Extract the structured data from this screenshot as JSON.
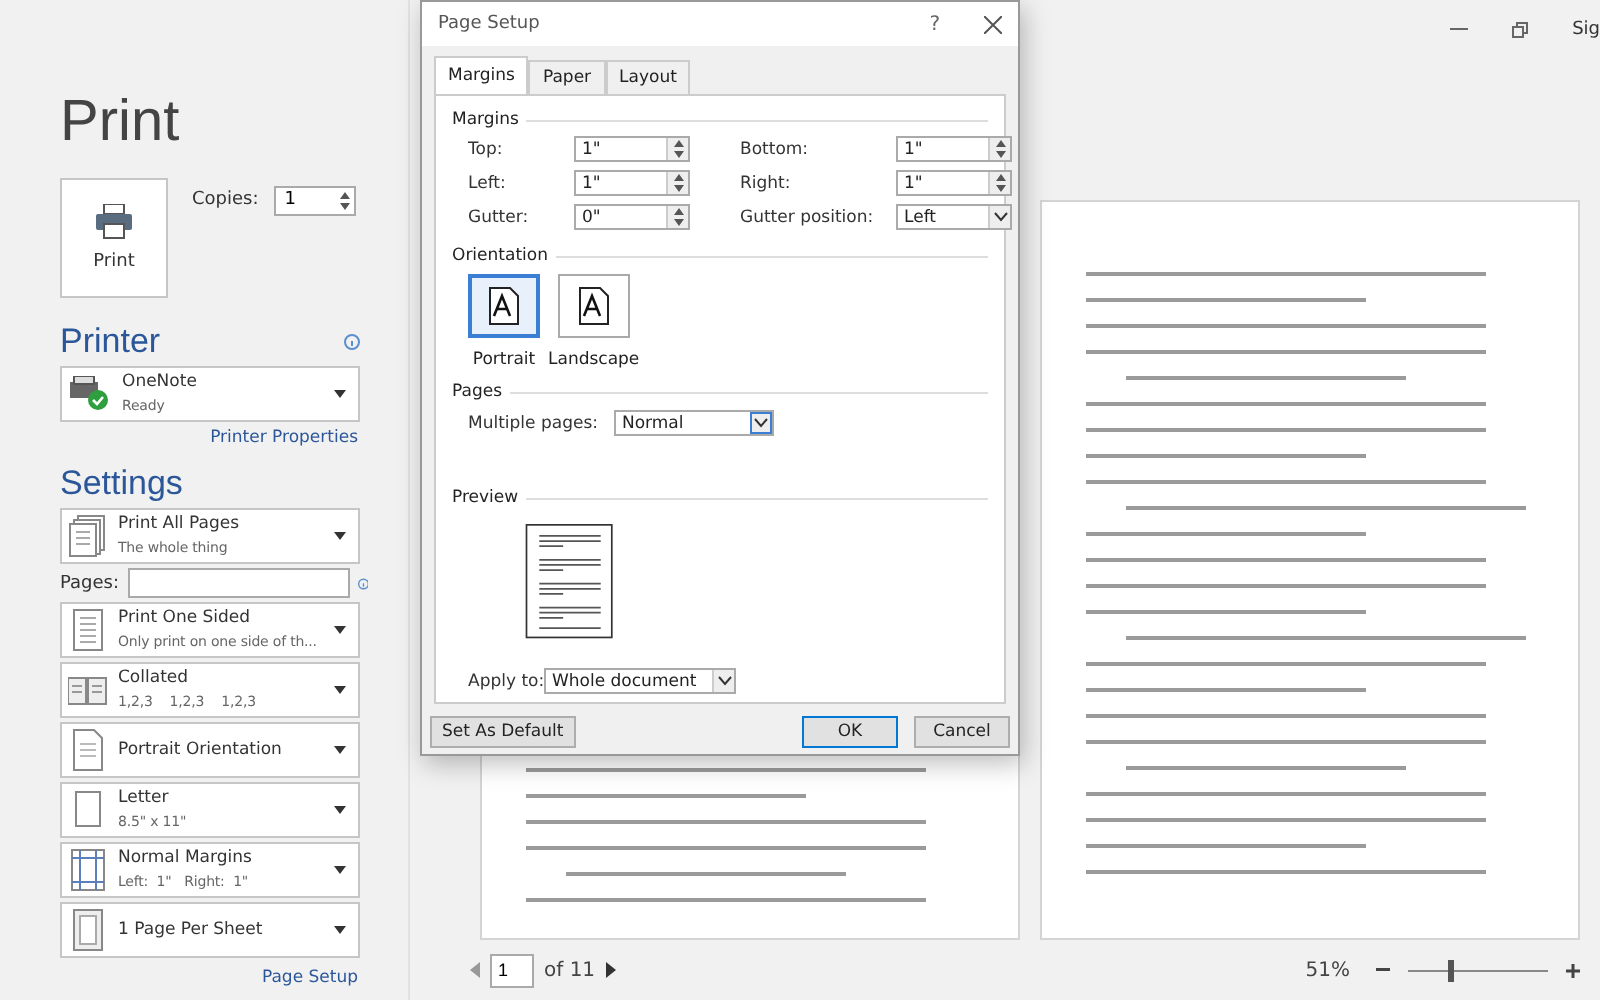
{
  "top_bar": {
    "account_label": "Sig"
  },
  "print": {
    "title": "Print",
    "print_button": "Print",
    "copies_label": "Copies:",
    "copies": "1"
  },
  "printer": {
    "heading": "Printer",
    "name": "OneNote",
    "status": "Ready",
    "properties_link": "Printer Properties"
  },
  "settings": {
    "heading": "Settings",
    "items": [
      {
        "kind": "dropdown",
        "title": "Print All Pages",
        "subtitle": "The whole thing"
      },
      {
        "kind": "pages_field",
        "label": "Pages:"
      },
      {
        "kind": "dropdown",
        "title": "Print One Sided",
        "subtitle": "Only print on one side of th..."
      },
      {
        "kind": "dropdown",
        "title": "Collated",
        "subtitle": "1,2,3    1,2,3    1,2,3"
      },
      {
        "kind": "dropdown",
        "title": "Portrait Orientation"
      },
      {
        "kind": "dropdown",
        "title": "Letter",
        "subtitle": "8.5\" x 11\""
      },
      {
        "kind": "dropdown",
        "title": "Normal Margins",
        "subtitle": "Left:  1\"   Right:  1\""
      },
      {
        "kind": "dropdown",
        "title": "1 Page Per Sheet"
      }
    ],
    "page_setup_link": "Page Setup"
  },
  "dialog": {
    "title": "Page Setup",
    "help": "?",
    "tabs": [
      {
        "label": "Margins",
        "selected": true
      },
      {
        "label": "Paper",
        "selected": false
      },
      {
        "label": "Layout",
        "selected": false
      }
    ],
    "margins_heading": "Margins",
    "fields": [
      {
        "label": "Top:",
        "value": "1\"",
        "kind": "spin"
      },
      {
        "label": "Bottom:",
        "value": "1\"",
        "kind": "spin"
      },
      {
        "label": "Left:",
        "value": "1\"",
        "kind": "spin"
      },
      {
        "label": "Right:",
        "value": "1\"",
        "kind": "spin"
      },
      {
        "label": "Gutter:",
        "value": "0\"",
        "kind": "spin"
      },
      {
        "label": "Gutter position:",
        "value": "Left",
        "kind": "select"
      }
    ],
    "orientation_heading": "Orientation",
    "orientations": [
      {
        "label": "Portrait",
        "selected": true
      },
      {
        "label": "Landscape",
        "selected": false
      }
    ],
    "pages_heading": "Pages",
    "multiple_pages_label": "Multiple pages:",
    "multiple_pages": "Normal",
    "preview_heading": "Preview",
    "apply_to_label": "Apply to:",
    "apply_to": "Whole document",
    "buttons": [
      {
        "label": "Set As Default",
        "kind": "secondary"
      },
      {
        "label": "OK",
        "kind": "default"
      },
      {
        "label": "Cancel",
        "kind": "secondary"
      }
    ]
  },
  "preview_nav": {
    "page": "1",
    "of_pages": "of 11",
    "zoom": "51%",
    "zoom_level": {
      "level": 0.28
    }
  }
}
